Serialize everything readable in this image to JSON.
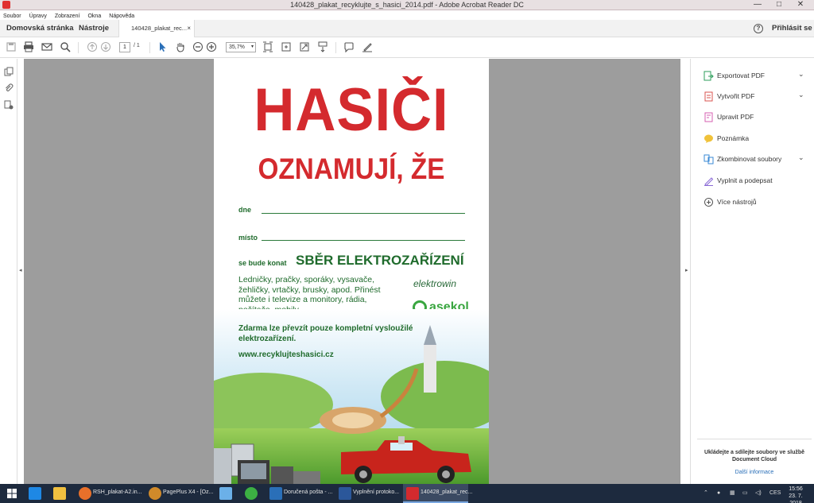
{
  "window": {
    "title": "140428_plakat_recyklujte_s_hasici_2014.pdf - Adobe Acrobat Reader DC",
    "controls": {
      "minimize": "—",
      "maximize": "□",
      "close": "✕"
    }
  },
  "menu": [
    "Soubor",
    "Úpravy",
    "Zobrazení",
    "Okna",
    "Nápověda"
  ],
  "tabs": {
    "home": "Domovská stránka",
    "tools": "Nástroje",
    "document": "140428_plakat_rec...",
    "close_symbol": "×",
    "help": "?",
    "signin": "Přihlásit se"
  },
  "toolbar": {
    "page_current": "1",
    "page_total": "/ 1",
    "zoom": "35,7%",
    "zoom_dropdown": "▾"
  },
  "document": {
    "title_line1": "HASIČI",
    "title_line2": "OZNAMUJÍ, ŽE",
    "field_date": "dne",
    "field_place": "místo",
    "collection_prefix": "se bude konat",
    "collection_title": "SBĚR ELEKTROZAŘÍZENÍ",
    "items_text": "Ledničky, pračky, sporáky, vysavače, žehličky, vrtačky, brusky, apod. Přinést můžete i televize a monitory, rádia, počítače, mobily.",
    "free_text": "Zdarma lze převzít pouze kompletní vysloužilé elektrozařízení.",
    "url": "www.recyklujteshasici.cz",
    "logo_elektrowin": "elektrowin",
    "logo_asekol": "asekol"
  },
  "right_panel": {
    "items": [
      {
        "label": "Exportovat PDF",
        "icon": "export-pdf-icon",
        "color": "#2e9e5b",
        "expandable": true
      },
      {
        "label": "Vytvořit PDF",
        "icon": "create-pdf-icon",
        "color": "#d9534f",
        "expandable": true
      },
      {
        "label": "Upravit PDF",
        "icon": "edit-pdf-icon",
        "color": "#d65fb0",
        "expandable": false
      },
      {
        "label": "Poznámka",
        "icon": "comment-icon",
        "color": "#f0c23a",
        "expandable": false
      },
      {
        "label": "Zkombinovat soubory",
        "icon": "combine-files-icon",
        "color": "#3a8ad6",
        "expandable": true
      },
      {
        "label": "Vyplnit a podepsat",
        "icon": "fill-sign-icon",
        "color": "#8a6ad6",
        "expandable": false
      },
      {
        "label": "Více nástrojů",
        "icon": "more-tools-icon",
        "color": "#555555",
        "expandable": false
      }
    ],
    "footer_text": "Ukládejte a sdílejte soubory ve službě Document Cloud",
    "footer_link": "Další informace"
  },
  "taskbar": {
    "items": [
      {
        "label": "",
        "icon": "edge-icon",
        "color": "#1e88e5"
      },
      {
        "label": "",
        "icon": "file-explorer-icon",
        "color": "#f0c040"
      },
      {
        "label": "RSH_plakat-A2.in...",
        "icon": "firefox-icon",
        "color": "#e8702a"
      },
      {
        "label": "PagePlus X4 - [Oz...",
        "icon": "pageplus-icon",
        "color": "#d08a2a"
      },
      {
        "label": "",
        "icon": "paint-icon",
        "color": "#6bb0e8"
      },
      {
        "label": "",
        "icon": "chrome-icon",
        "color": "#3cb043"
      },
      {
        "label": "Doručená pošta - ...",
        "icon": "mail-icon",
        "color": "#2a6fb8"
      },
      {
        "label": "Vyplnění protoko...",
        "icon": "word-icon",
        "color": "#2b579a"
      },
      {
        "label": "140428_plakat_rec...",
        "icon": "acrobat-icon",
        "color": "#d42a2e"
      }
    ],
    "language": "CES",
    "time": "15:56",
    "date": "23. 7. 2018"
  }
}
